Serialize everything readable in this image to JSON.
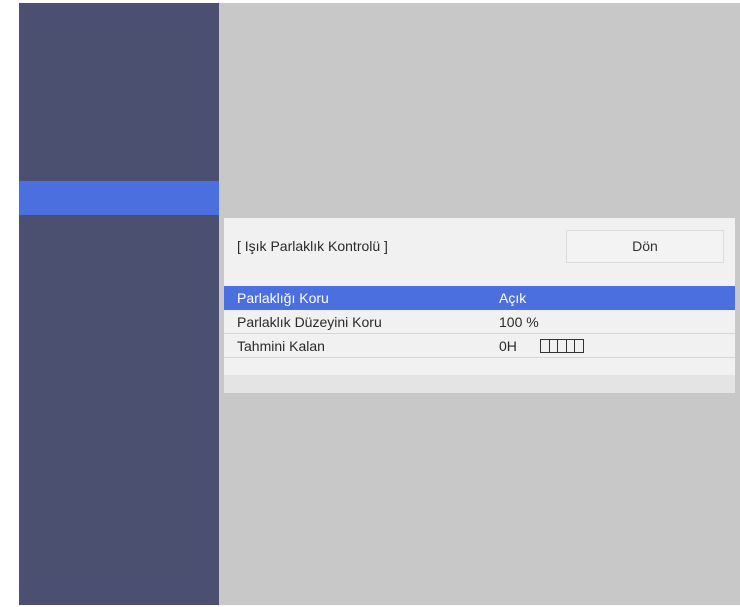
{
  "panel": {
    "title": "[ Işık Parlaklık Kontrolü ]",
    "back_label": "Dön"
  },
  "menu": {
    "rows": [
      {
        "label": "Parlaklığı Koru",
        "value": "Açık",
        "selected": true
      },
      {
        "label": "Parlaklık Düzeyini Koru",
        "value": "100 %"
      },
      {
        "label": "Tahmini Kalan",
        "value": "0H",
        "gauge_segments": 5
      }
    ]
  },
  "colors": {
    "sidebar": "#4b5071",
    "highlight": "#4c6fe0",
    "background": "#c8c8c8",
    "panel": "#f1f1f1"
  }
}
